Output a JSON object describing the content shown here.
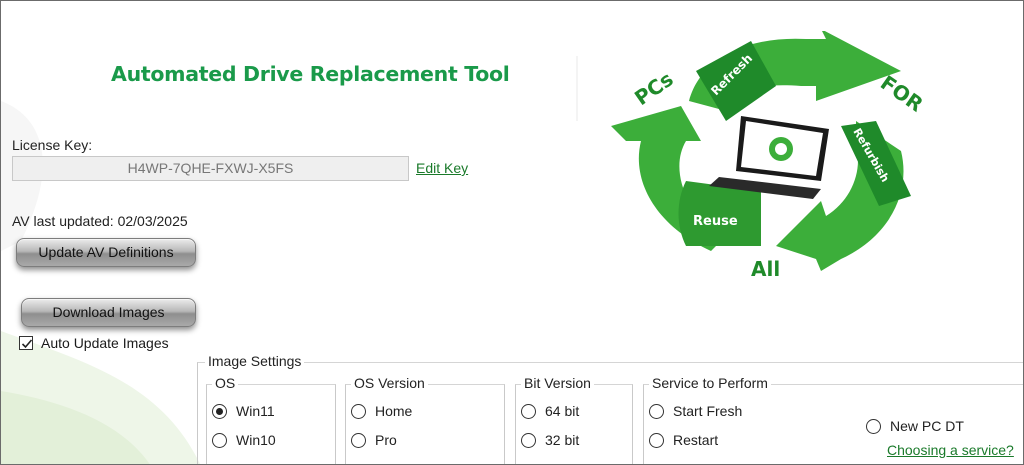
{
  "app": {
    "title": "Automated Drive Replacement Tool"
  },
  "logo": {
    "pcs": "PCs",
    "for": "FOR",
    "all": "All",
    "refresh": "Refresh",
    "refurbish": "Refurbish",
    "reuse": "Reuse"
  },
  "license": {
    "label": "License Key:",
    "value": "H4WP-7QHE-FXWJ-X5FS",
    "edit_link": "Edit Key"
  },
  "av": {
    "last_updated": "AV last updated: 02/03/2025",
    "update_button": "Update AV Definitions"
  },
  "images": {
    "download_button": "Download Images",
    "auto_update_label": "Auto Update Images",
    "auto_update_checked": true
  },
  "image_settings": {
    "title": "Image Settings",
    "os": {
      "title": "OS",
      "options": [
        {
          "label": "Win11",
          "selected": true
        },
        {
          "label": "Win10",
          "selected": false
        }
      ]
    },
    "os_version": {
      "title": "OS Version",
      "options": [
        {
          "label": "Home",
          "selected": false
        },
        {
          "label": "Pro",
          "selected": false
        }
      ]
    },
    "bit_version": {
      "title": "Bit Version",
      "options": [
        {
          "label": "64 bit",
          "selected": false
        },
        {
          "label": "32 bit",
          "selected": false
        }
      ]
    },
    "service": {
      "title": "Service to Perform",
      "options": [
        {
          "label": "Start Fresh",
          "selected": false
        },
        {
          "label": "Restart",
          "selected": false
        },
        {
          "label": "New PC DT",
          "selected": false
        }
      ],
      "help_link": "Choosing a service?"
    }
  },
  "colors": {
    "brand_green": "#1a9a4a",
    "arrow_green": "#3cae3a",
    "link_green": "#1a7a2a"
  }
}
